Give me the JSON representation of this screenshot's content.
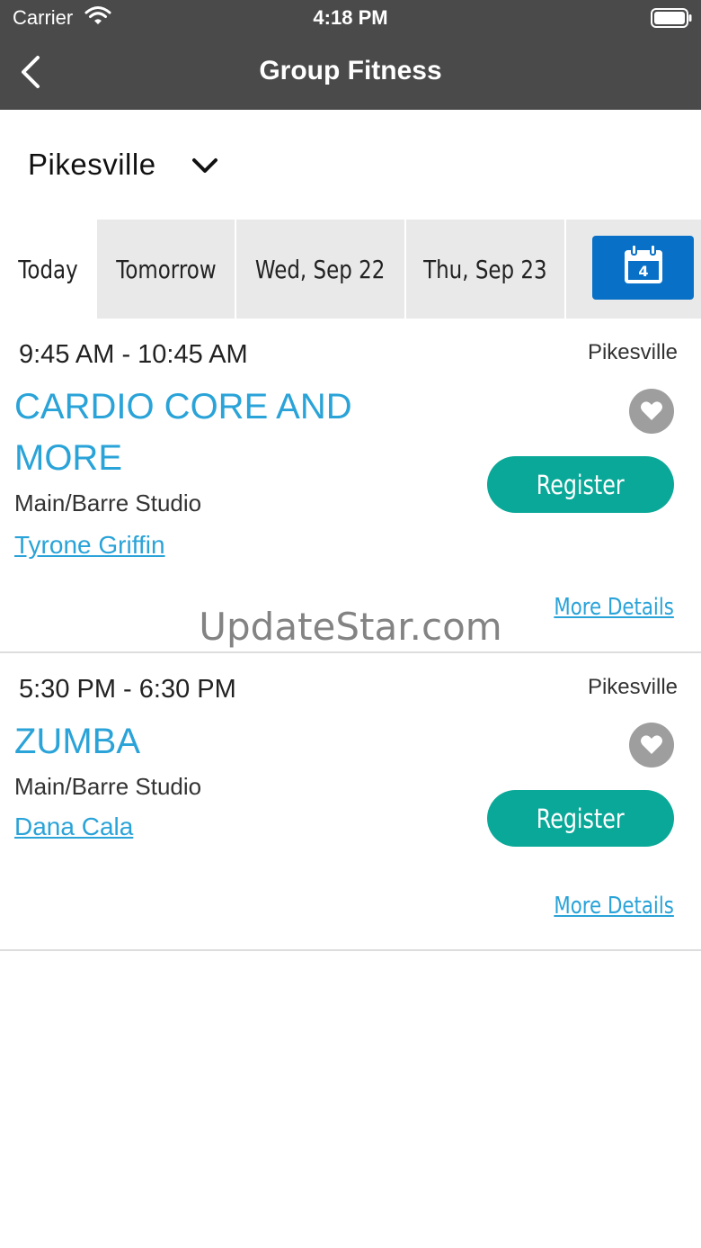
{
  "status_bar": {
    "carrier": "Carrier",
    "time": "4:18 PM"
  },
  "nav": {
    "title": "Group Fitness"
  },
  "location_selector": {
    "value": "Pikesville"
  },
  "date_tabs": [
    {
      "label": "Today",
      "active": true
    },
    {
      "label": "Tomorrow",
      "active": false
    },
    {
      "label": "Wed, Sep 22",
      "active": false
    },
    {
      "label": "Thu, Sep 23",
      "active": false
    }
  ],
  "calendar_button": {
    "day": "4"
  },
  "classes": [
    {
      "time": "9:45 AM - 10:45 AM",
      "location": "Pikesville",
      "name": "CARDIO CORE AND MORE",
      "room": "Main/Barre Studio",
      "instructor": "Tyrone Griffin",
      "register_label": "Register",
      "more_details_label": "More Details"
    },
    {
      "time": "5:30 PM - 6:30 PM",
      "location": "Pikesville",
      "name": "ZUMBA",
      "room": "Main/Barre Studio",
      "instructor": "Dana Cala",
      "register_label": "Register",
      "more_details_label": "More Details"
    }
  ],
  "watermark": "UpdateStar.com",
  "colors": {
    "header_bg": "#4a4a4a",
    "accent_blue": "#2aa3d8",
    "register_green": "#0aa898",
    "calendar_blue": "#0870c6"
  }
}
